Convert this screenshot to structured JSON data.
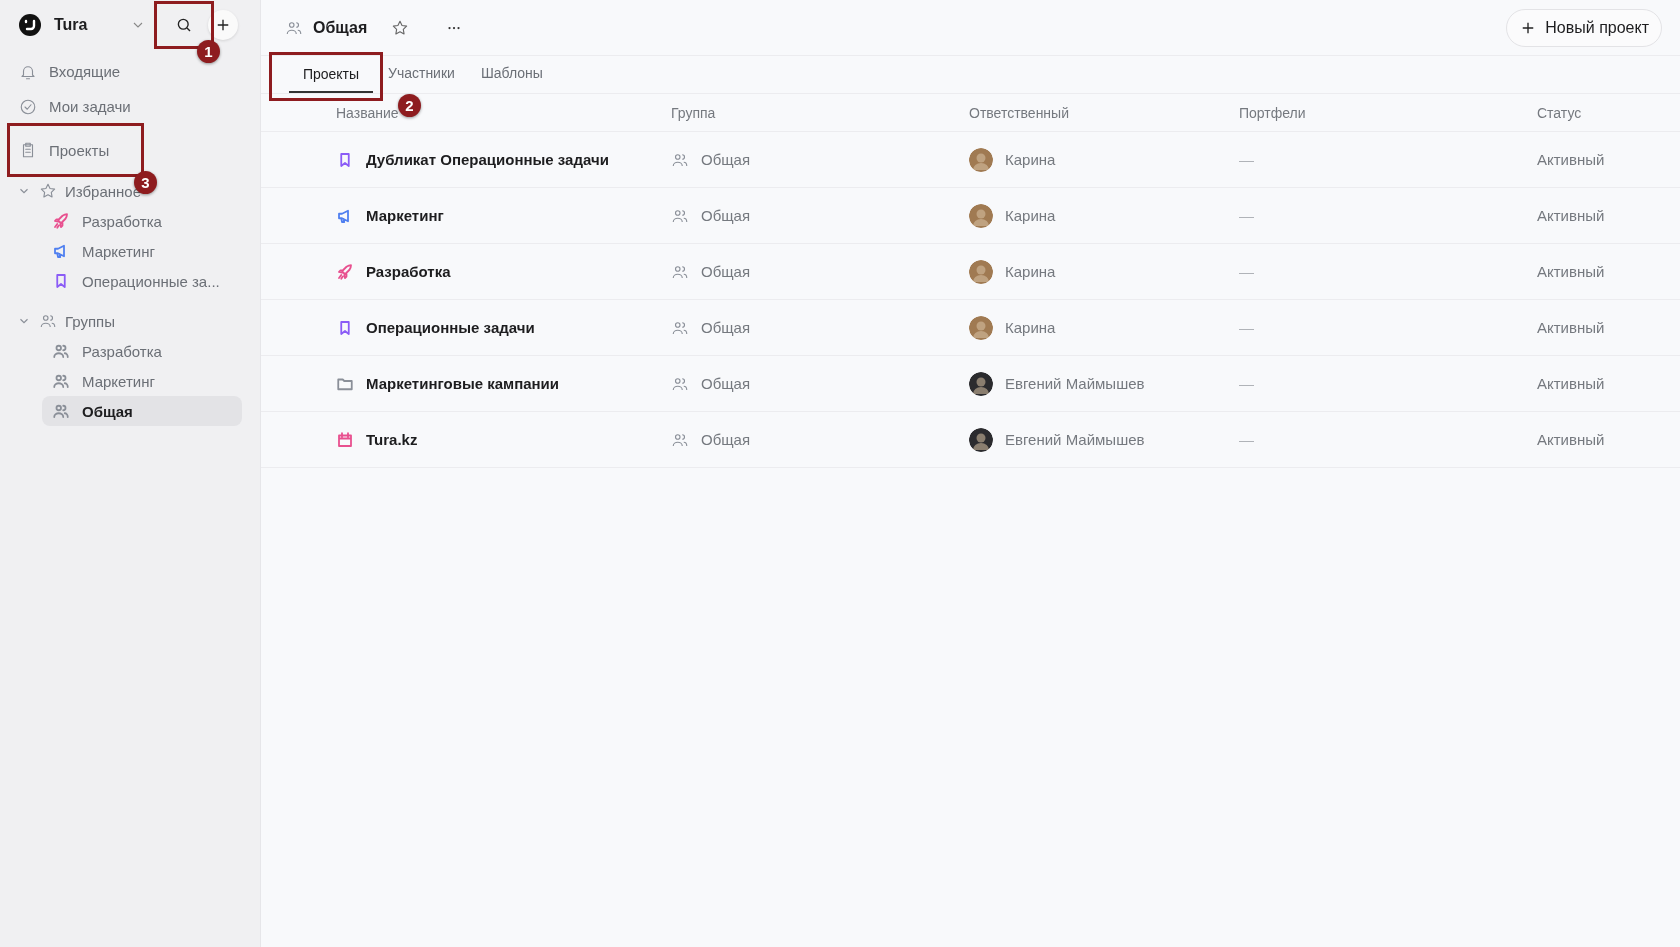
{
  "workspace": {
    "name": "Tura",
    "search_annotation": "1"
  },
  "top_nav": [
    {
      "label": "Входящие",
      "kind": "bell",
      "selected": false
    },
    {
      "label": "Мои задачи",
      "kind": "check",
      "selected": false
    },
    {
      "label": "Проекты",
      "kind": "clipboard",
      "selected": false,
      "annotation": "3"
    }
  ],
  "sections": [
    {
      "title": "Избранное",
      "kind": "star",
      "expanded": true,
      "items": [
        {
          "label": "Разработка",
          "kind": "rocket",
          "color": "#e8508f",
          "selected": false
        },
        {
          "label": "Маркетинг",
          "kind": "megaphone",
          "color": "#4f7ff0",
          "selected": false
        },
        {
          "label": "Операционные за...",
          "kind": "bookmark",
          "color": "#8b5cf6",
          "selected": false
        }
      ]
    },
    {
      "title": "Группы",
      "kind": "users",
      "expanded": true,
      "items": [
        {
          "label": "Разработка",
          "kind": "users",
          "color": "#8a8f98",
          "selected": false
        },
        {
          "label": "Маркетинг",
          "kind": "users",
          "color": "#8a8f98",
          "selected": false
        },
        {
          "label": "Общая",
          "kind": "users",
          "color": "#8a8f98",
          "selected": true
        }
      ]
    }
  ],
  "header": {
    "title": "Общая",
    "new_button": "Новый проект"
  },
  "tabs": [
    {
      "label": "Проекты",
      "selected": true,
      "annotation": "2"
    },
    {
      "label": "Участники",
      "selected": false
    },
    {
      "label": "Шаблоны",
      "selected": false
    }
  ],
  "table": {
    "columns": [
      "Название",
      "Группа",
      "Ответственный",
      "Портфели",
      "Статус"
    ],
    "rows": [
      {
        "name": "Дубликат Операционные задачи",
        "kind": "bookmark",
        "color": "#8b5cf6",
        "group": "Общая",
        "owner": {
          "name": "Карина",
          "color": "#a07a52"
        },
        "portfolio": "—",
        "status": "Активный"
      },
      {
        "name": "Маркетинг",
        "kind": "megaphone",
        "color": "#4f7ff0",
        "group": "Общая",
        "owner": {
          "name": "Карина",
          "color": "#a07a52"
        },
        "portfolio": "—",
        "status": "Активный"
      },
      {
        "name": "Разработка",
        "kind": "rocket",
        "color": "#e8508f",
        "group": "Общая",
        "owner": {
          "name": "Карина",
          "color": "#a07a52"
        },
        "portfolio": "—",
        "status": "Активный"
      },
      {
        "name": "Операционные задачи",
        "kind": "bookmark",
        "color": "#8b5cf6",
        "group": "Общая",
        "owner": {
          "name": "Карина",
          "color": "#a07a52"
        },
        "portfolio": "—",
        "status": "Активный"
      },
      {
        "name": "Маркетинговые кампании",
        "kind": "folder",
        "color": "#8a8f98",
        "group": "Общая",
        "owner": {
          "name": "Евгений Маймышев",
          "color": "#2b2b2e"
        },
        "portfolio": "—",
        "status": "Активный"
      },
      {
        "name": "Tura.kz",
        "kind": "calendar",
        "color": "#e8508f",
        "group": "Общая",
        "owner": {
          "name": "Евгений Маймышев",
          "color": "#2b2b2e"
        },
        "portfolio": "—",
        "status": "Активный"
      }
    ]
  }
}
